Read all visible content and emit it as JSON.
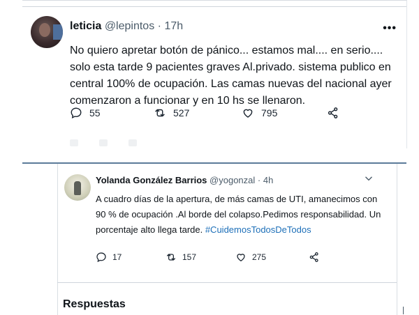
{
  "tweet1": {
    "display_name": "leticia",
    "handle": "@lepintos",
    "separator": "·",
    "time": "17h",
    "more_icon": "more-horizontal-icon",
    "text": "No quiero  apretar botón  de pánico... estamos mal.... en serio.... solo esta tarde 9 pacientes graves Al.privado.  sistema publico en central 100% de ocupación. Las camas nuevas del nacional  ayer comenzaron a funcionar y en 10 hs se llenaron.",
    "replies": "55",
    "retweets": "527",
    "likes": "795"
  },
  "tweet2": {
    "display_name": "Yolanda González Barrios",
    "handle": "@yogonzal",
    "separator": "·",
    "time": "4h",
    "menu_icon": "chevron-down-icon",
    "text_main": "A cuadro días de la apertura, de más camas de UTI, amanecimos con 90 % de ocupación .Al borde del colapso.Pedimos responsabilidad. Un porcentaje alto llega tarde. ",
    "hashtag": "#CuidemosTodosDeTodos",
    "replies": "17",
    "retweets": "157",
    "likes": "275"
  },
  "replies_section": {
    "heading": "Respuestas"
  },
  "colors": {
    "text": "#0f1419",
    "secondary": "#4b5b69",
    "hashtag": "#1d6fb8",
    "divider": "#5b7b99"
  }
}
